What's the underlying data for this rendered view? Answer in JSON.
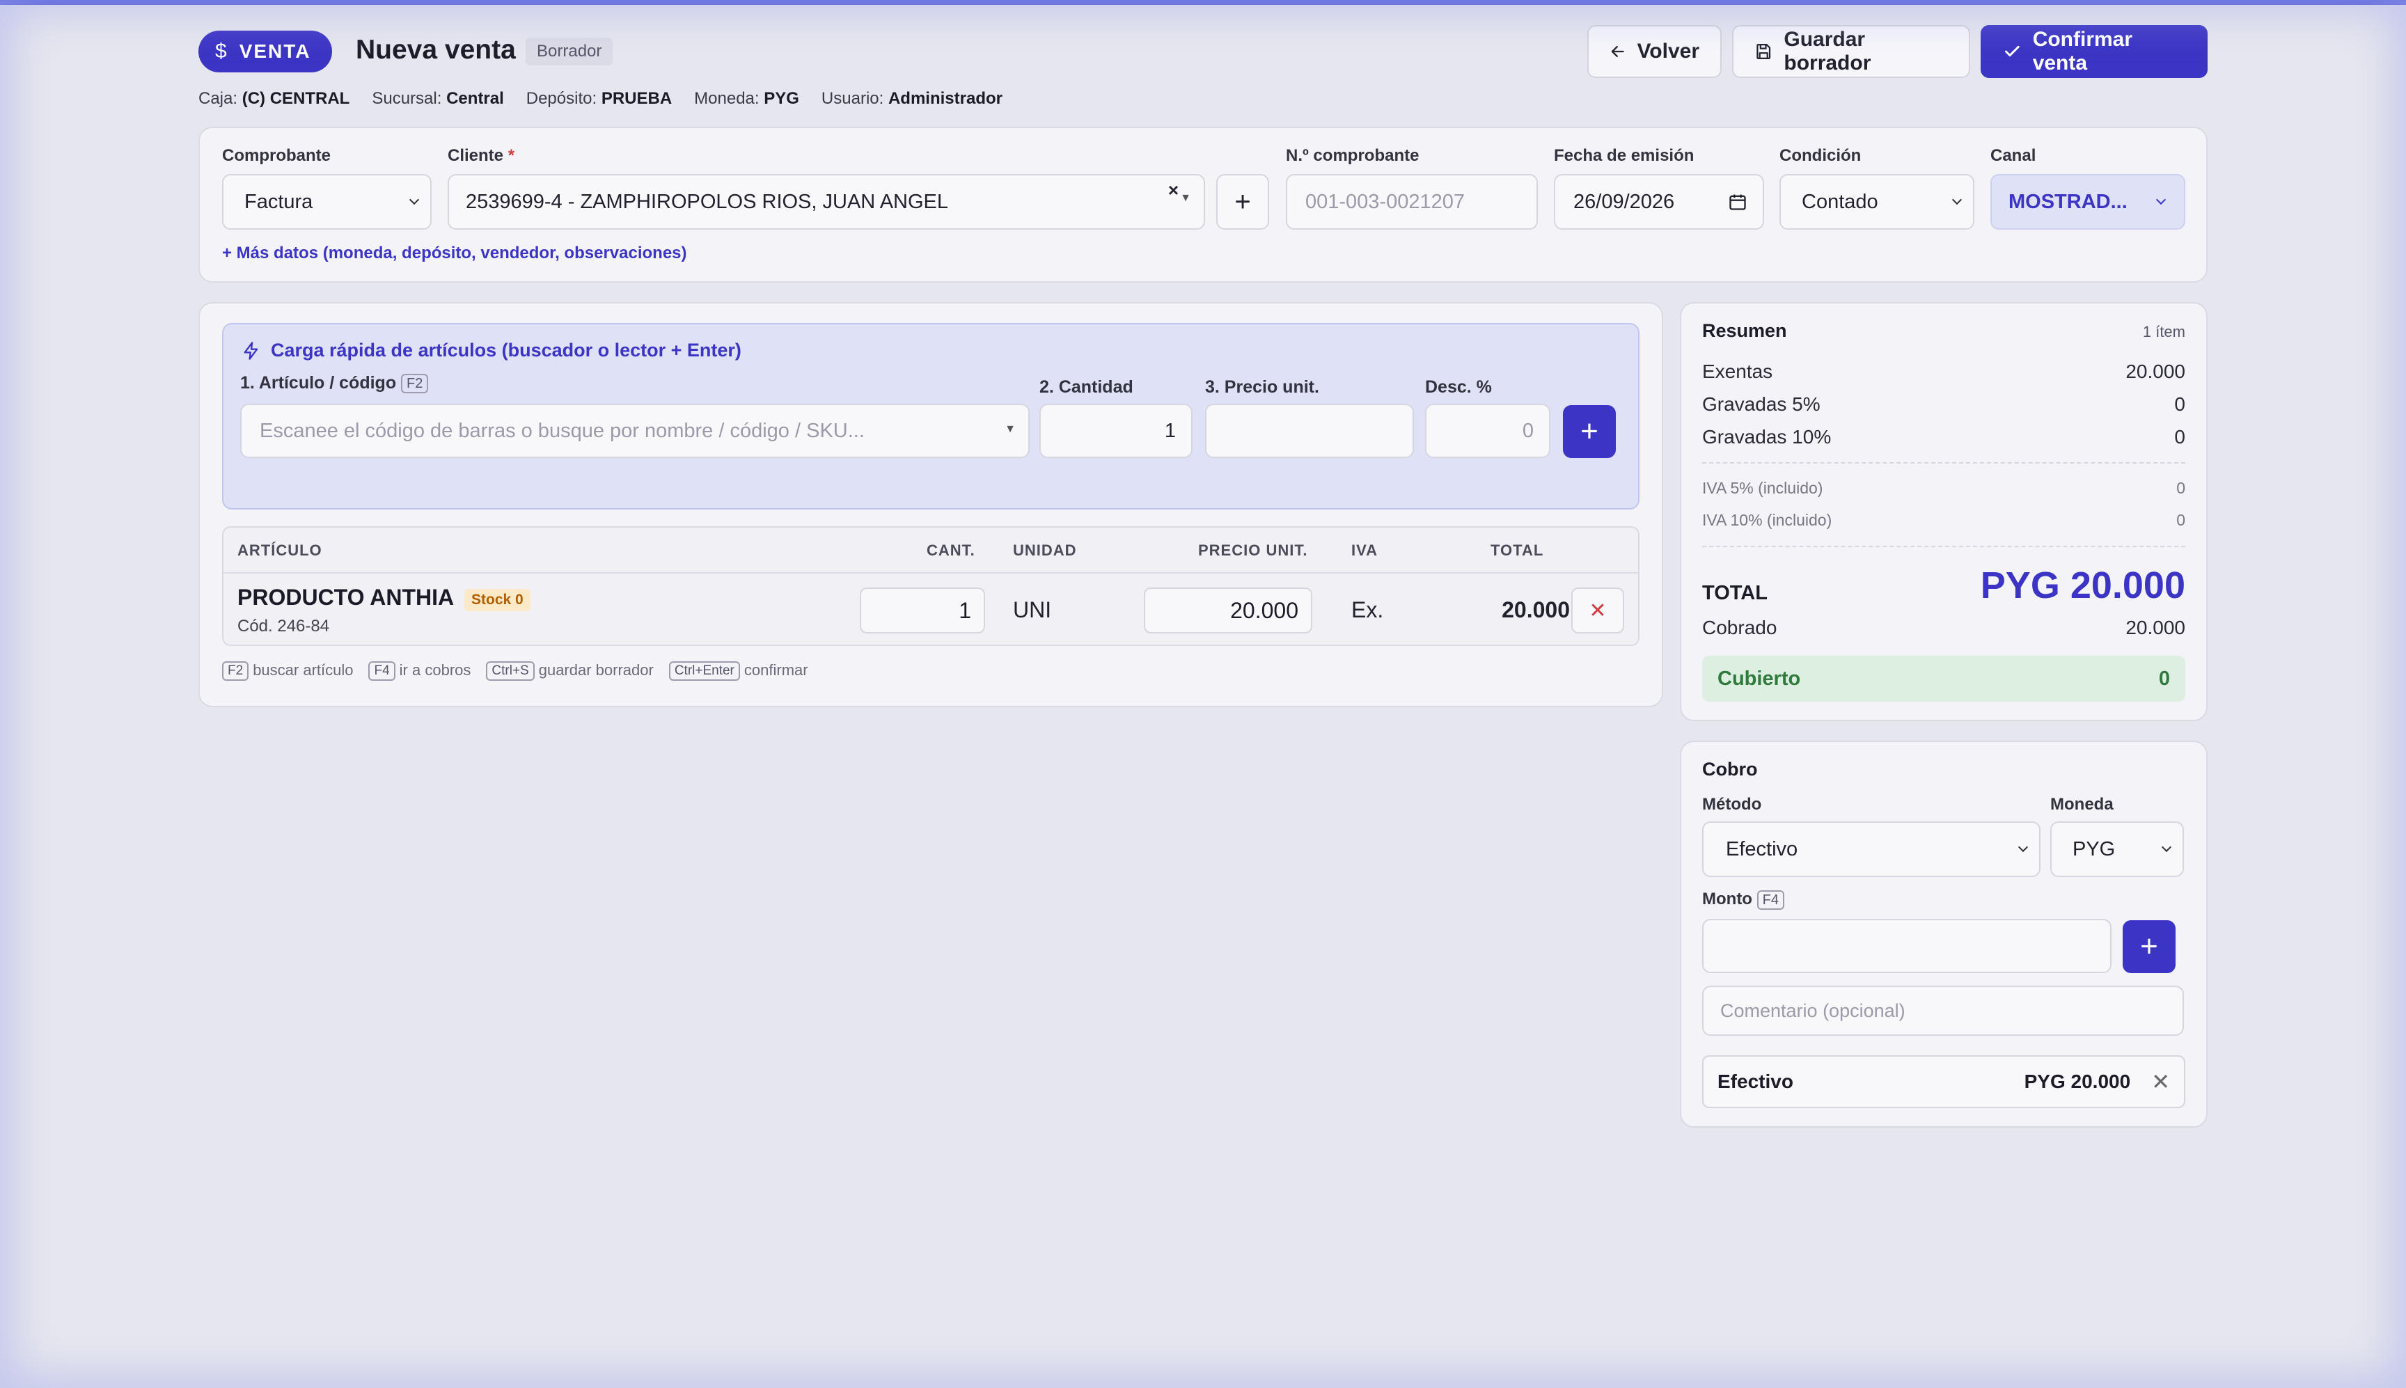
{
  "header": {
    "badge": "VENTA",
    "title": "Nueva venta",
    "status": "Borrador",
    "buttons": {
      "back": "Volver",
      "save_draft": "Guardar borrador",
      "confirm": "Confirmar venta"
    },
    "meta": [
      {
        "label": "Caja:",
        "value": "(C) CENTRAL"
      },
      {
        "label": "Sucursal:",
        "value": "Central"
      },
      {
        "label": "Depósito:",
        "value": "PRUEBA"
      },
      {
        "label": "Moneda:",
        "value": "PYG"
      },
      {
        "label": "Usuario:",
        "value": "Administrador"
      }
    ]
  },
  "form": {
    "comprobante": {
      "label": "Comprobante",
      "value": "Factura"
    },
    "cliente": {
      "label": "Cliente",
      "required_mark": "*",
      "value": "2539699-4 - ZAMPHIROPOLOS RIOS, JUAN ANGEL"
    },
    "numero": {
      "label": "N.º comprobante",
      "placeholder": "001-003-0021207"
    },
    "fecha": {
      "label": "Fecha de emisión",
      "value": "26/09/2026"
    },
    "condicion": {
      "label": "Condición",
      "value": "Contado"
    },
    "canal": {
      "label": "Canal",
      "value": "MOSTRAD..."
    },
    "more_link": "+ Más datos (moneda, depósito, vendedor, observaciones)"
  },
  "quick_add": {
    "title": "Carga rápida de artículos (buscador o lector + Enter)",
    "article_label": "1. Artículo / código",
    "article_key": "F2",
    "article_placeholder": "Escanee el código de barras o busque por nombre / código / SKU...",
    "qty_label": "2. Cantidad",
    "qty_value": "1",
    "price_label": "3. Precio unit.",
    "price_value": "",
    "disc_label": "Desc. %",
    "disc_value": "0"
  },
  "items_table": {
    "headers": {
      "article": "ARTÍCULO",
      "qty": "CANT.",
      "unit": "UNIDAD",
      "price": "PRECIO UNIT.",
      "iva": "IVA",
      "total": "TOTAL"
    },
    "rows": [
      {
        "name": "PRODUCTO ANTHIA",
        "stock": "Stock 0",
        "code": "Cód. 246-84",
        "qty": "1",
        "unit": "UNI",
        "price": "20.000",
        "iva": "Ex.",
        "total": "20.000"
      }
    ]
  },
  "shortcuts": [
    {
      "key": "F2",
      "text": "buscar artículo"
    },
    {
      "key": "F4",
      "text": "ir a cobros"
    },
    {
      "key": "Ctrl+S",
      "text": "guardar borrador"
    },
    {
      "key": "Ctrl+Enter",
      "text": "confirmar"
    }
  ],
  "summary": {
    "title": "Resumen",
    "count": "1 ítem",
    "rows": [
      {
        "label": "Exentas",
        "value": "20.000"
      },
      {
        "label": "Gravadas 5%",
        "value": "0"
      },
      {
        "label": "Gravadas 10%",
        "value": "0"
      }
    ],
    "iva_rows": [
      {
        "label": "IVA 5% (incluido)",
        "value": "0"
      },
      {
        "label": "IVA 10% (incluido)",
        "value": "0"
      }
    ],
    "total_label": "TOTAL",
    "total_value": "PYG 20.000",
    "cobrado_label": "Cobrado",
    "cobrado_value": "20.000",
    "cubierto_label": "Cubierto",
    "cubierto_value": "0"
  },
  "cobro": {
    "title": "Cobro",
    "method_label": "Método",
    "method_value": "Efectivo",
    "currency_label": "Moneda",
    "currency_value": "PYG",
    "amount_label": "Monto",
    "amount_key": "F4",
    "amount_value": "",
    "comment_placeholder": "Comentario (opcional)",
    "payments": [
      {
        "method": "Efectivo",
        "amount": "PYG 20.000"
      }
    ]
  },
  "colors": {
    "primary": "#3b34c4",
    "danger": "#d23c3c",
    "success_bg": "#dcefe0",
    "success_text": "#2f7a3c",
    "stock_badge": "#b35f00"
  },
  "icons": [
    "dollar-icon",
    "arrow-left-icon",
    "save-icon",
    "check-icon",
    "lightning-icon",
    "calendar-icon",
    "plus-icon",
    "close-icon",
    "chevron-down-icon"
  ]
}
